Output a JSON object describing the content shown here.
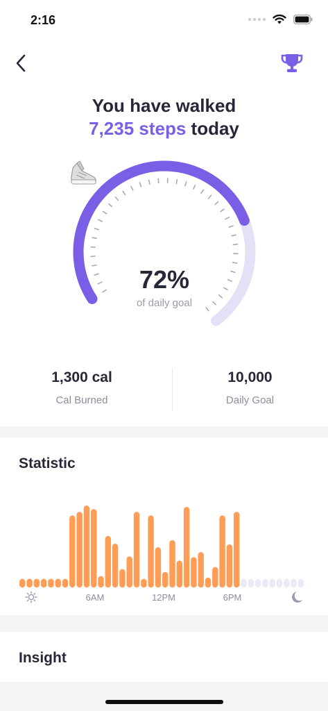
{
  "status_bar": {
    "time": "2:16"
  },
  "header": {
    "back_icon": "chevron-left-icon",
    "trophy_icon": "trophy-icon",
    "line1": "You have walked",
    "steps": "7,235 steps",
    "today": "today"
  },
  "gauge": {
    "progress": 0.72,
    "percent_text": "72%",
    "caption": "of daily goal",
    "icon": "shoe-icon",
    "colors": {
      "progress": "#7b5ee6",
      "track": "#e4e0f6",
      "ticks": "#a7a8ba"
    }
  },
  "stats": {
    "cal_value": "1,300 cal",
    "cal_label": "Cal Burned",
    "goal_value": "10,000",
    "goal_label": "Daily Goal"
  },
  "statistic": {
    "title": "Statistic",
    "chart_data": {
      "type": "bar",
      "x_tick_labels": [
        "6AM",
        "12PM",
        "6PM"
      ],
      "start_icon": "sun-icon",
      "end_icon": "moon-icon",
      "bar_color": "#ff9d57",
      "inactive_color": "#eceaf6",
      "values": [
        0.8,
        0.8,
        0.8,
        0.8,
        0.8,
        0.8,
        0.8,
        9.8,
        10.3,
        11.2,
        10.7,
        1.2,
        6.9,
        5.8,
        2.2,
        4.0,
        10.3,
        0.8,
        9.8,
        5.3,
        1.8,
        6.3,
        3.4,
        11.0,
        3.9,
        4.6,
        1.0,
        2.5,
        9.8,
        5.7,
        10.3
      ],
      "inactive_values": [
        0.8,
        0.8,
        0.8,
        0.8,
        0.8,
        0.8,
        0.8,
        0.8,
        0.8
      ],
      "ylim": [
        0,
        12
      ]
    }
  },
  "insight": {
    "title": "Insight"
  }
}
